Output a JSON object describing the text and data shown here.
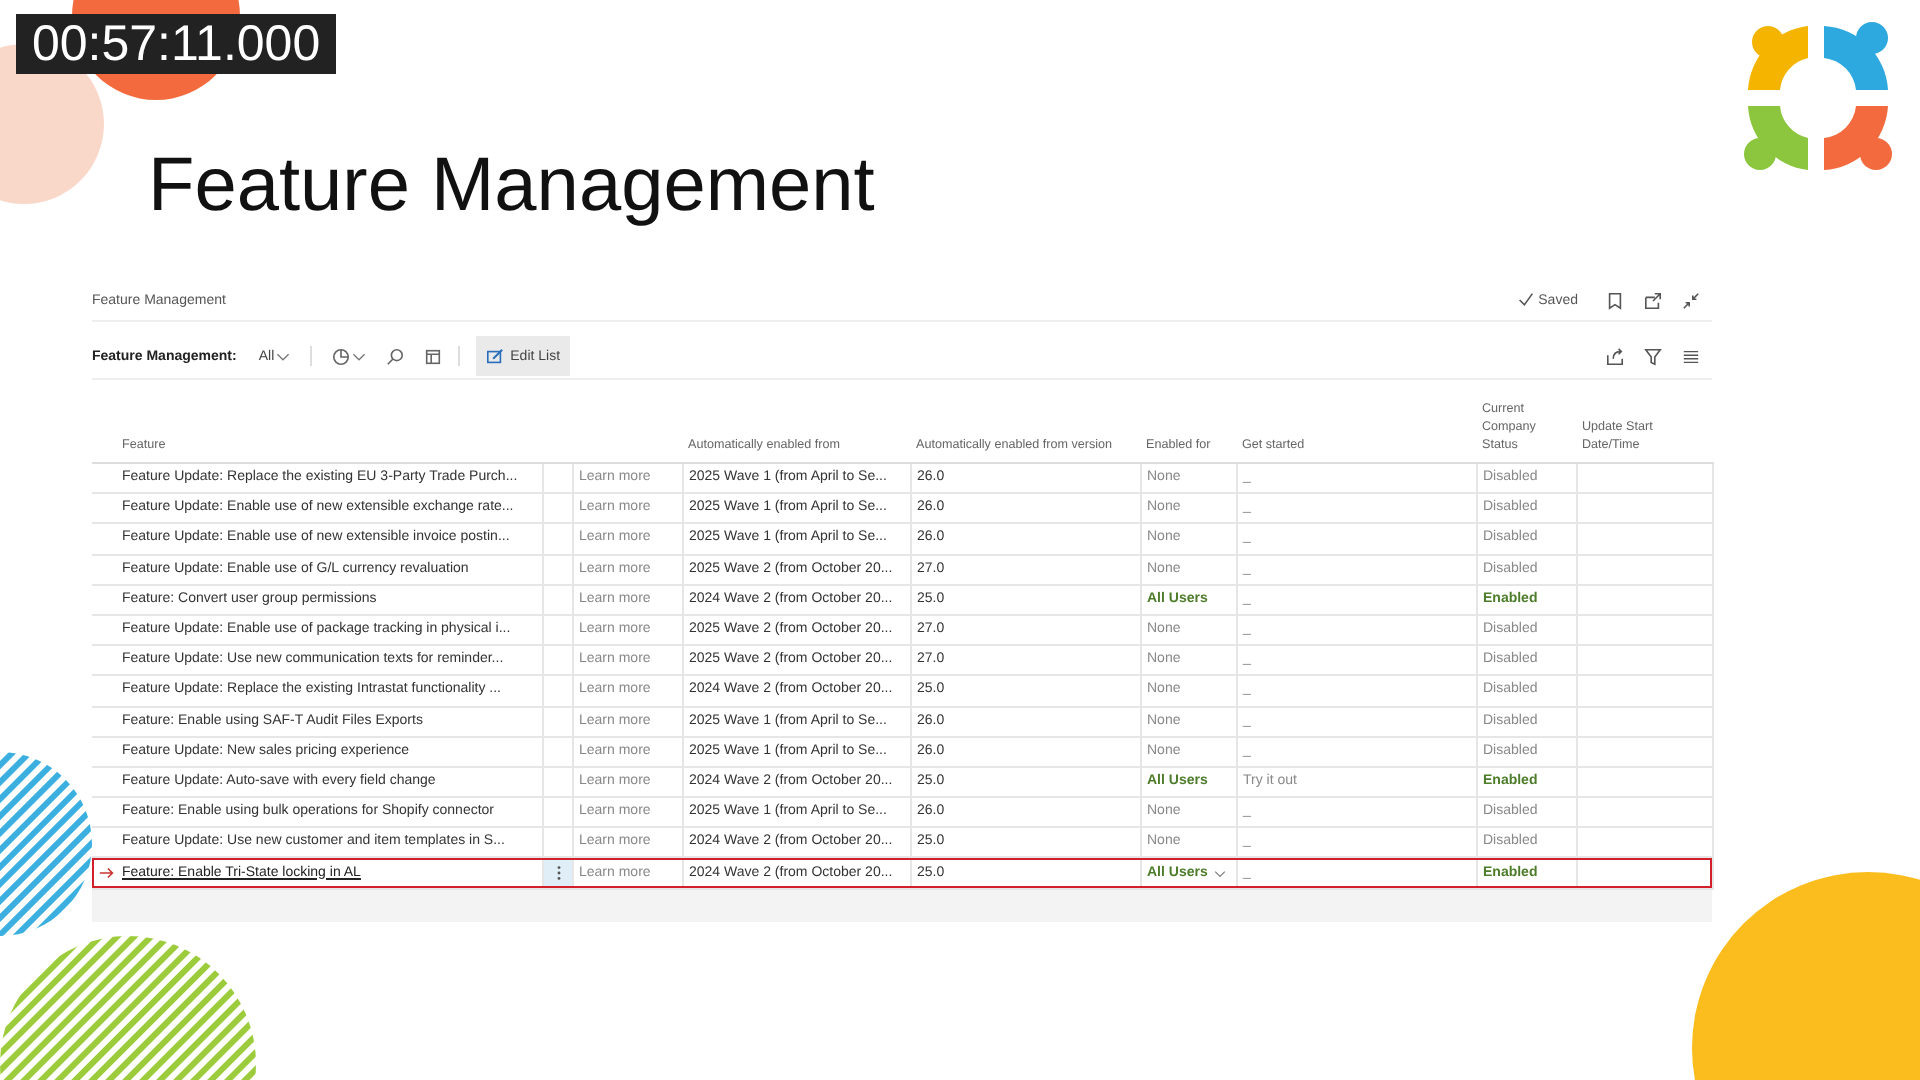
{
  "timecode": "00:57:11.000",
  "slide_title": "Feature Management",
  "page": {
    "title": "Feature Management",
    "saved": "Saved",
    "filter_label": "Feature Management:",
    "filter_value": "All",
    "edit_list": "Edit List",
    "columns": [
      "Feature",
      "Automatically enabled from",
      "Automatically enabled from version",
      "Enabled for",
      "Get started",
      "Current Company Status",
      "Update Start Date/Time"
    ],
    "rows": [
      {
        "feature": "Feature Update: Replace the existing EU 3-Party Trade Purch...",
        "learn_more": "Learn more",
        "enabled_from": "2025 Wave 1 (from April to Se...",
        "version": "26.0",
        "enabled_for": "None",
        "get_started": "_",
        "status": "Disabled",
        "enabled": false,
        "selected": false
      },
      {
        "feature": "Feature Update: Enable use of new extensible exchange rate...",
        "learn_more": "Learn more",
        "enabled_from": "2025 Wave 1 (from April to Se...",
        "version": "26.0",
        "enabled_for": "None",
        "get_started": "_",
        "status": "Disabled",
        "enabled": false,
        "selected": false
      },
      {
        "feature": "Feature Update: Enable use of new extensible invoice postin...",
        "learn_more": "Learn more",
        "enabled_from": "2025 Wave 1 (from April to Se...",
        "version": "26.0",
        "enabled_for": "None",
        "get_started": "_",
        "status": "Disabled",
        "enabled": false,
        "selected": false
      },
      {
        "feature": "Feature Update: Enable use of G/L currency revaluation",
        "learn_more": "Learn more",
        "enabled_from": "2025 Wave 2 (from October 20...",
        "version": "27.0",
        "enabled_for": "None",
        "get_started": "_",
        "status": "Disabled",
        "enabled": false,
        "selected": false
      },
      {
        "feature": "Feature: Convert user group permissions",
        "learn_more": "Learn more",
        "enabled_from": "2024 Wave 2 (from October 20...",
        "version": "25.0",
        "enabled_for": "All Users",
        "get_started": "_",
        "status": "Enabled",
        "enabled": true,
        "selected": false
      },
      {
        "feature": "Feature Update: Enable use of package tracking in physical i...",
        "learn_more": "Learn more",
        "enabled_from": "2025 Wave 2 (from October 20...",
        "version": "27.0",
        "enabled_for": "None",
        "get_started": "_",
        "status": "Disabled",
        "enabled": false,
        "selected": false
      },
      {
        "feature": "Feature Update: Use new communication texts for reminder...",
        "learn_more": "Learn more",
        "enabled_from": "2025 Wave 2 (from October 20...",
        "version": "27.0",
        "enabled_for": "None",
        "get_started": "_",
        "status": "Disabled",
        "enabled": false,
        "selected": false
      },
      {
        "feature": "Feature Update: Replace the existing Intrastat functionality ...",
        "learn_more": "Learn more",
        "enabled_from": "2024 Wave 2 (from October 20...",
        "version": "25.0",
        "enabled_for": "None",
        "get_started": "_",
        "status": "Disabled",
        "enabled": false,
        "selected": false
      },
      {
        "feature": "Feature: Enable using SAF-T Audit Files Exports",
        "learn_more": "Learn more",
        "enabled_from": "2025 Wave 1 (from April to Se...",
        "version": "26.0",
        "enabled_for": "None",
        "get_started": "_",
        "status": "Disabled",
        "enabled": false,
        "selected": false
      },
      {
        "feature": "Feature Update: New sales pricing experience",
        "learn_more": "Learn more",
        "enabled_from": "2025 Wave 1 (from April to Se...",
        "version": "26.0",
        "enabled_for": "None",
        "get_started": "_",
        "status": "Disabled",
        "enabled": false,
        "selected": false
      },
      {
        "feature": "Feature Update: Auto-save with every field change",
        "learn_more": "Learn more",
        "enabled_from": "2024 Wave 2 (from October 20...",
        "version": "25.0",
        "enabled_for": "All Users",
        "get_started": "Try it out",
        "status": "Enabled",
        "enabled": true,
        "selected": false
      },
      {
        "feature": "Feature: Enable using bulk operations for Shopify connector",
        "learn_more": "Learn more",
        "enabled_from": "2025 Wave 1 (from April to Se...",
        "version": "26.0",
        "enabled_for": "None",
        "get_started": "_",
        "status": "Disabled",
        "enabled": false,
        "selected": false
      },
      {
        "feature": "Feature Update: Use new customer and item templates in S...",
        "learn_more": "Learn more",
        "enabled_from": "2024 Wave 2 (from October 20...",
        "version": "25.0",
        "enabled_for": "None",
        "get_started": "_",
        "status": "Disabled",
        "enabled": false,
        "selected": false
      },
      {
        "feature": "Feature: Enable Tri-State locking in AL",
        "learn_more": "Learn more",
        "enabled_from": "2024 Wave 2 (from October 20...",
        "version": "25.0",
        "enabled_for": "All Users",
        "get_started": "_",
        "status": "Enabled",
        "enabled": true,
        "selected": true
      }
    ]
  }
}
